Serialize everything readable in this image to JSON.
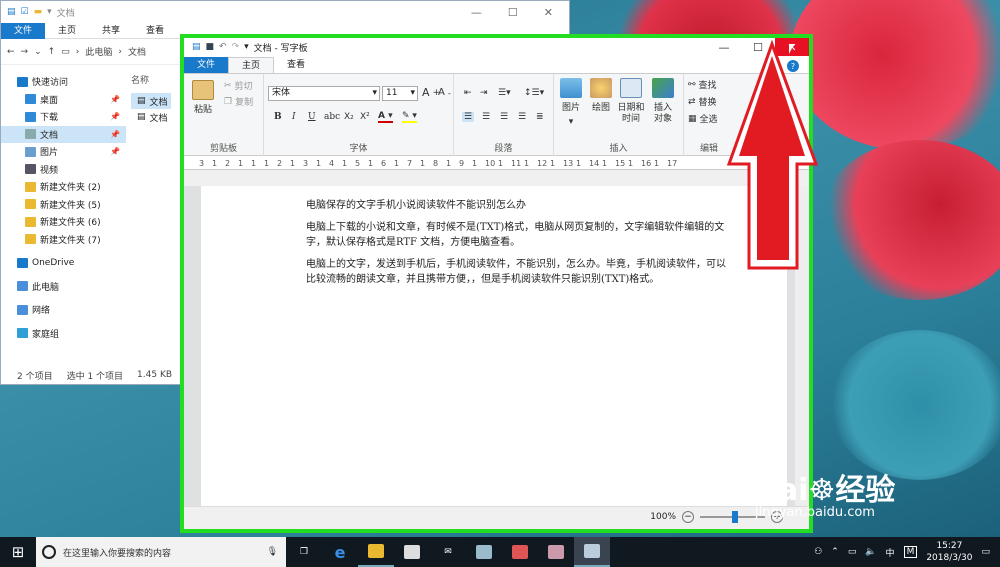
{
  "explorer": {
    "title": "文档",
    "tabs": [
      "文件",
      "主页",
      "共享",
      "查看"
    ],
    "breadcrumb": [
      "此电脑",
      "文档"
    ],
    "nav": [
      {
        "label": "快速访问",
        "icon": "star-icon",
        "top": true
      },
      {
        "label": "桌面",
        "icon": "desktop-icon",
        "pin": true
      },
      {
        "label": "下载",
        "icon": "download-icon",
        "pin": true
      },
      {
        "label": "文档",
        "icon": "document-icon",
        "pin": true,
        "selected": true
      },
      {
        "label": "图片",
        "icon": "picture-icon",
        "pin": true
      },
      {
        "label": "视频",
        "icon": "video-icon"
      },
      {
        "label": "新建文件夹 (2)",
        "icon": "folder-icon"
      },
      {
        "label": "新建文件夹 (5)",
        "icon": "folder-icon"
      },
      {
        "label": "新建文件夹 (6)",
        "icon": "folder-icon"
      },
      {
        "label": "新建文件夹 (7)",
        "icon": "folder-icon"
      },
      {
        "label": "OneDrive",
        "icon": "cloud-icon",
        "top": true
      },
      {
        "label": "此电脑",
        "icon": "computer-icon",
        "top": true
      },
      {
        "label": "网络",
        "icon": "network-icon",
        "top": true
      },
      {
        "label": "家庭组",
        "icon": "homegroup-icon",
        "top": true
      }
    ],
    "column_header": "名称",
    "files": [
      "文档",
      "文档"
    ],
    "status": {
      "count": "2 个项目",
      "selected": "选中 1 个项目",
      "size": "1.45 KB"
    }
  },
  "wordpad": {
    "title": "文档 - 写字板",
    "tabs": {
      "file": "文件",
      "home": "主页",
      "view": "查看"
    },
    "clipboard": {
      "paste": "粘贴",
      "cut": "剪切",
      "copy": "复制",
      "label": "剪贴板"
    },
    "font": {
      "family": "宋体",
      "size": "11",
      "label": "字体"
    },
    "paragraph": {
      "label": "段落"
    },
    "insert": {
      "picture": "图片",
      "paint": "绘图",
      "datetime": "日期和时间",
      "object": "插入对象",
      "label": "插入"
    },
    "editing": {
      "find": "查找",
      "replace": "替换",
      "selectall": "全选",
      "label": "编辑"
    },
    "ruler": [
      "3",
      "1",
      "2",
      "1",
      "1",
      "1",
      "2",
      "1",
      "3",
      "1",
      "4",
      "1",
      "5",
      "1",
      "6",
      "1",
      "7",
      "1",
      "8",
      "1",
      "9",
      "1",
      "10",
      "1",
      "11",
      "1",
      "12",
      "1",
      "13",
      "1",
      "14",
      "1",
      "15",
      "1",
      "16",
      "1",
      "17"
    ],
    "document": [
      "电脑保存的文字手机小说阅读软件不能识别怎么办",
      "电脑上下载的小说和文章，有时候不是(TXT)格式，电脑从网页复制的，文字编辑软件编辑的文字，默认保存格式是RTF 文档，方便电脑查看。",
      "电脑上的文字，发送到手机后，手机阅读软件，不能识别，怎么办。毕竟，手机阅读软件，可以比较流畅的朗读文章，并且携带方便，，但是手机阅读软件只能识别(TXT)格式。"
    ],
    "zoom": "100%"
  },
  "taskbar": {
    "search_placeholder": "在这里输入你要搜索的内容",
    "ime": "中",
    "ime_mode": "M",
    "time": "15:27",
    "date": "2018/3/30"
  },
  "watermark": {
    "brand": "Bai",
    "brand2": "经验",
    "url": "jingyan.baidu.com"
  },
  "colors": {
    "accent": "#1979ca",
    "highlight_frame": "#22dd22",
    "arrow": "#e21b23",
    "close": "#e81123"
  }
}
